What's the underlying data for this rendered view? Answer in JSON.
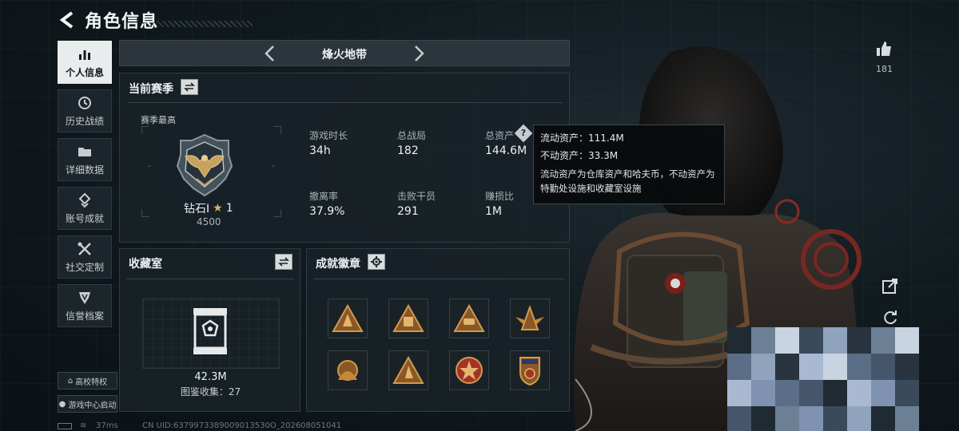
{
  "header": {
    "title": "角色信息"
  },
  "nav": [
    {
      "label": "个人信息",
      "icon": "bar-chart-icon",
      "active": true
    },
    {
      "label": "历史战绩",
      "icon": "clock-icon",
      "active": false
    },
    {
      "label": "详细数据",
      "icon": "folder-icon",
      "active": false
    },
    {
      "label": "账号成就",
      "icon": "achievement-icon",
      "active": false
    },
    {
      "label": "社交定制",
      "icon": "tools-icon",
      "active": false
    },
    {
      "label": "信誉档案",
      "icon": "shield-icon",
      "active": false
    }
  ],
  "bottom_buttons": {
    "campus": "高校特权",
    "game_center": "游戏中心启动"
  },
  "season": {
    "name": "烽火地带"
  },
  "current_season": {
    "title": "当前赛季",
    "best_label": "赛季最高",
    "rank_name": "钻石Ⅰ",
    "rank_stars": "1",
    "rank_points": "4500",
    "stats": [
      {
        "label": "游戏时长",
        "value": "34h"
      },
      {
        "label": "总战局",
        "value": "182"
      },
      {
        "label": "总资产",
        "value": "144.6M"
      },
      {
        "label": "撤离率",
        "value": "37.9%"
      },
      {
        "label": "击败干员",
        "value": "291"
      },
      {
        "label": "赚损比",
        "value": "1M"
      }
    ]
  },
  "tooltip": {
    "liquid": "流动资产：111.4M",
    "fixed": "不动资产：33.3M",
    "desc": "流动资产为仓库资产和哈夫币，不动资产为特勤处设施和收藏室设施"
  },
  "collection": {
    "title": "收藏室",
    "value": "42.3M",
    "catalog": "图鉴收集：27"
  },
  "achievements": {
    "title": "成就徽章",
    "badges": [
      {
        "icon": "triangle-badge-icon",
        "color": "#c8863a"
      },
      {
        "icon": "triangle-badge-icon",
        "color": "#c8863a"
      },
      {
        "icon": "triangle-badge-icon",
        "color": "#c8863a"
      },
      {
        "icon": "winged-badge-icon",
        "color": "#c8863a"
      },
      {
        "icon": "gear-badge-icon",
        "color": "#c8863a"
      },
      {
        "icon": "triangle-badge-icon",
        "color": "#c8863a"
      },
      {
        "icon": "star-medal-icon",
        "color": "#b03a2e"
      },
      {
        "icon": "shield-medal-icon",
        "color": "#c8863a"
      }
    ]
  },
  "likes": {
    "count": "181"
  },
  "footer": {
    "ping": "37ms",
    "uid": "CN UID:6379973389009013530O_202608051041"
  },
  "colors": {
    "accent": "#eef1f2",
    "panel": "#18212799",
    "gold": "#c8863a"
  }
}
